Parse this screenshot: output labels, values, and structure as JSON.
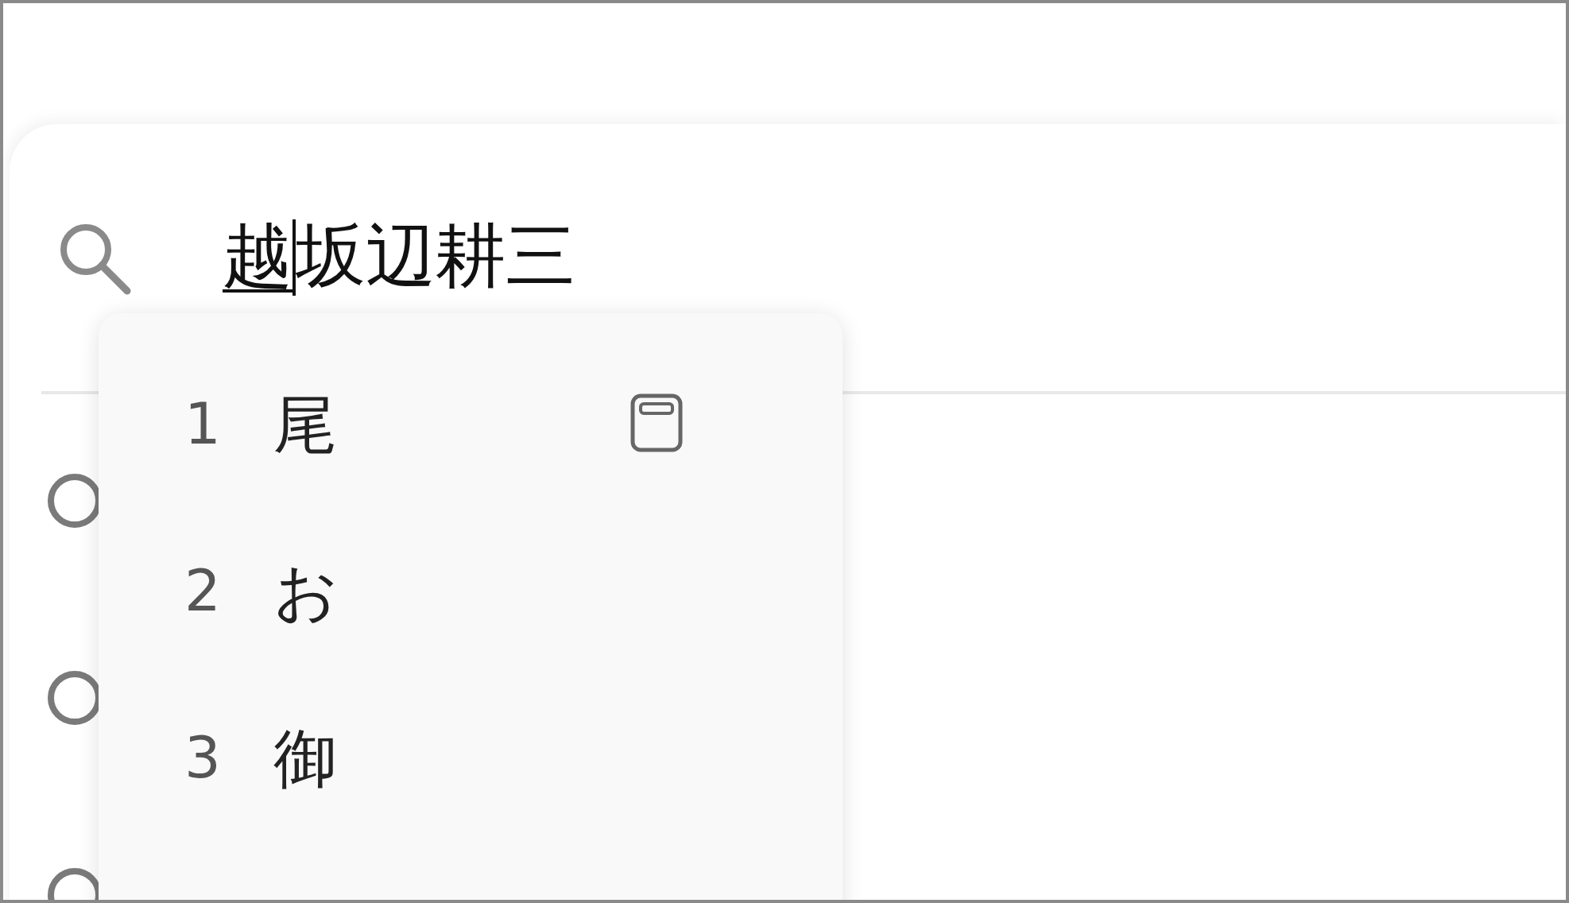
{
  "search": {
    "segments": [
      {
        "text": "越",
        "composing": true
      },
      {
        "text": "坂辺耕三",
        "composing": false
      }
    ]
  },
  "candidates": [
    {
      "number": "1",
      "text": "尾",
      "kind": "dictionary"
    },
    {
      "number": "2",
      "text": "お",
      "kind": "plain"
    },
    {
      "number": "3",
      "text": "御",
      "kind": "plain"
    }
  ]
}
